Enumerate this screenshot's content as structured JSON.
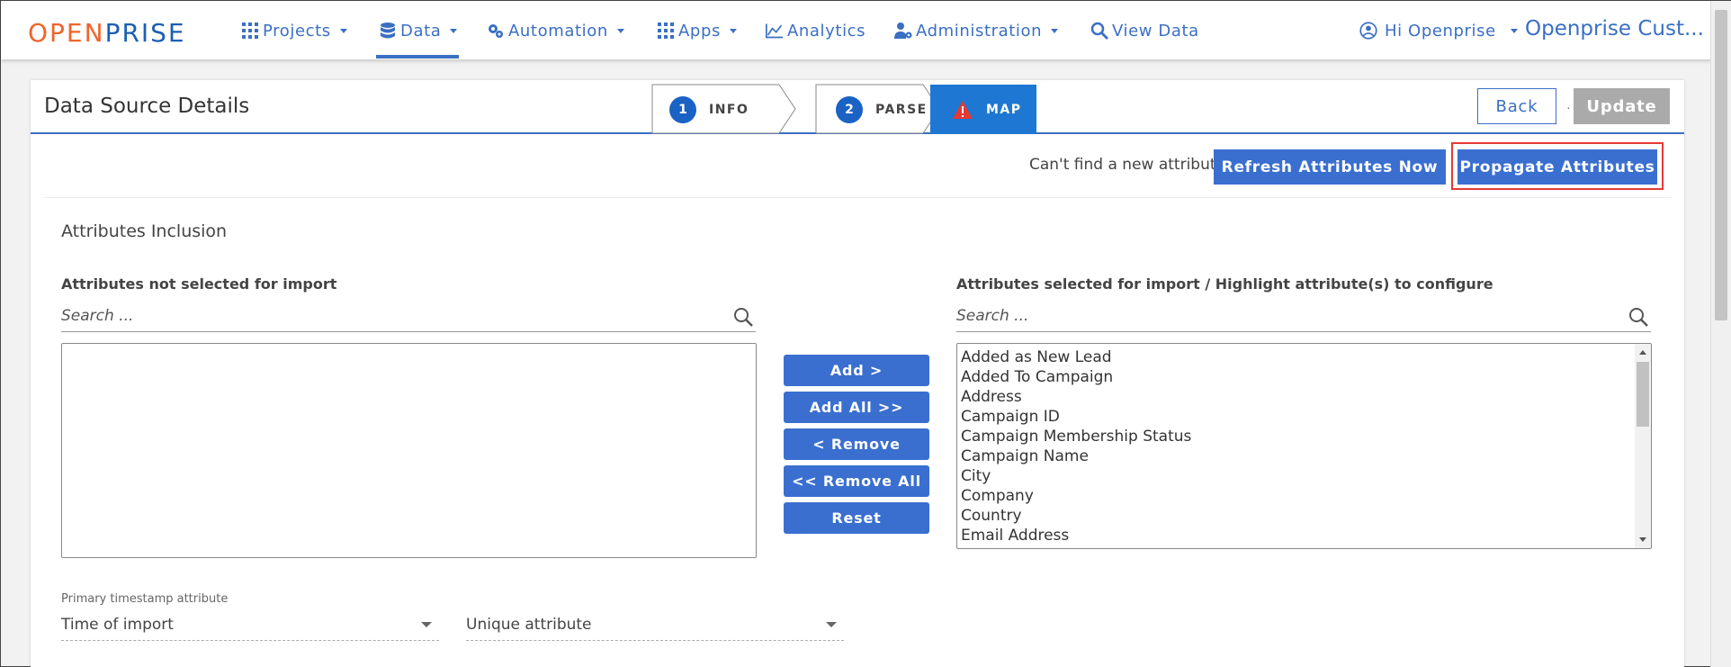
{
  "brand": {
    "open": "OPEN",
    "prise": "PRISE",
    "color_orange": "#f0642c",
    "color_blue": "#1b5fb3"
  },
  "nav": {
    "items": [
      {
        "label": "Projects",
        "icon": "grid-icon",
        "caret": true
      },
      {
        "label": "Data",
        "icon": "database-icon",
        "caret": true,
        "active": true
      },
      {
        "label": "Automation",
        "icon": "gears-icon",
        "caret": true
      },
      {
        "label": "Apps",
        "icon": "grid-icon",
        "caret": true
      },
      {
        "label": "Analytics",
        "icon": "chart-icon",
        "caret": false
      },
      {
        "label": "Administration",
        "icon": "user-gear-icon",
        "caret": true
      },
      {
        "label": "View Data",
        "icon": "search-icon",
        "caret": false
      }
    ],
    "user_greeting": "Hi Openprise",
    "org_name": "Openprise Cust...",
    "accent": "#3a6fc4"
  },
  "card": {
    "title": "Data Source Details",
    "steps": [
      {
        "num": "1",
        "label": "INFO"
      },
      {
        "num": "2",
        "label": "PARSE"
      },
      {
        "label": "MAP",
        "icon": "warning-icon",
        "active": true
      }
    ],
    "back_label": "Back",
    "update_label": "Update",
    "separator": "·"
  },
  "actions": {
    "cant_find": "Can't find a new attribute?",
    "refresh_label": "Refresh Attributes Now",
    "propagate_label": "Propagate Attributes"
  },
  "inclusion": {
    "title": "Attributes Inclusion",
    "left_label": "Attributes not selected for import",
    "right_label": "Attributes selected for import / Highlight attribute(s) to configure",
    "search_placeholder": "Search ...",
    "left_items": [],
    "right_items": [
      "Added as New Lead",
      "Added To Campaign",
      "Address",
      "Campaign ID",
      "Campaign Membership Status",
      "Campaign Name",
      "City",
      "Company",
      "Country",
      "Email Address"
    ],
    "buttons": {
      "add": "Add >",
      "add_all": "Add All >>",
      "remove": "< Remove",
      "remove_all": "<< Remove All",
      "reset": "Reset"
    }
  },
  "timestamp": {
    "label": "Primary timestamp attribute",
    "value": "Time of import",
    "unique_placeholder": "Unique attribute"
  }
}
